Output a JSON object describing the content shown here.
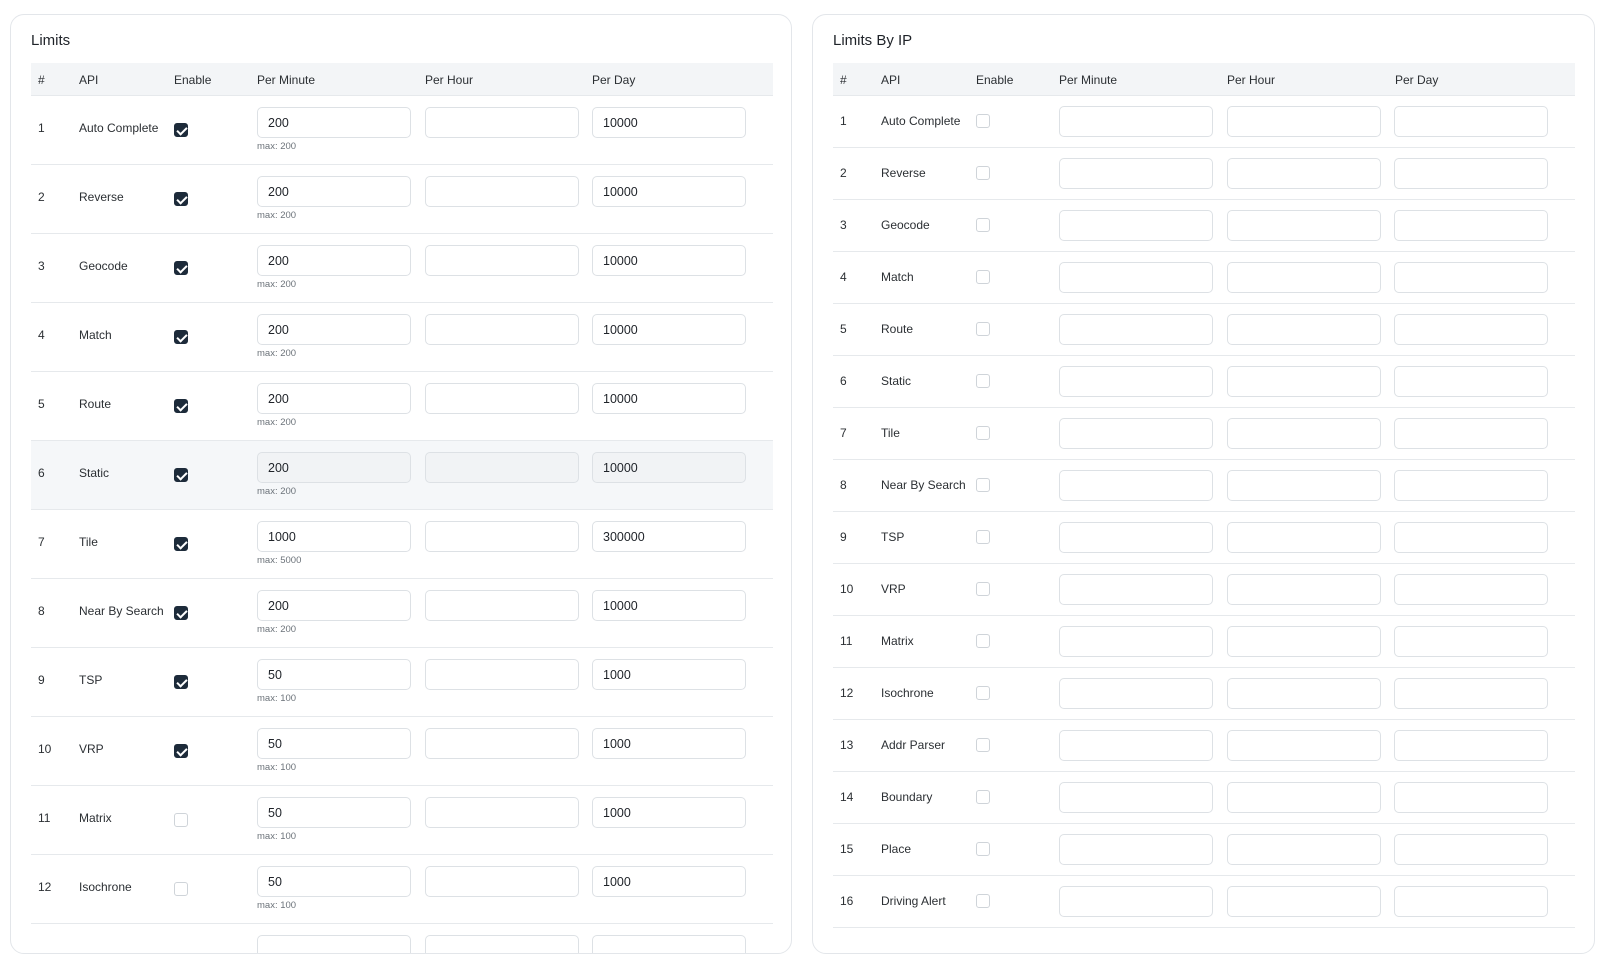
{
  "left": {
    "title": "Limits",
    "headers": [
      "#",
      "API",
      "Enable",
      "Per Minute",
      "Per Hour",
      "Per Day"
    ],
    "rows": [
      {
        "num": "1",
        "api": "Auto Complete",
        "enabled": true,
        "per_minute": "200",
        "per_hour": "",
        "per_day": "10000",
        "max": "max: 200"
      },
      {
        "num": "2",
        "api": "Reverse",
        "enabled": true,
        "per_minute": "200",
        "per_hour": "",
        "per_day": "10000",
        "max": "max: 200"
      },
      {
        "num": "3",
        "api": "Geocode",
        "enabled": true,
        "per_minute": "200",
        "per_hour": "",
        "per_day": "10000",
        "max": "max: 200"
      },
      {
        "num": "4",
        "api": "Match",
        "enabled": true,
        "per_minute": "200",
        "per_hour": "",
        "per_day": "10000",
        "max": "max: 200"
      },
      {
        "num": "5",
        "api": "Route",
        "enabled": true,
        "per_minute": "200",
        "per_hour": "",
        "per_day": "10000",
        "max": "max: 200"
      },
      {
        "num": "6",
        "api": "Static",
        "enabled": true,
        "per_minute": "200",
        "per_hour": "",
        "per_day": "10000",
        "max": "max: 200",
        "highlighted": true
      },
      {
        "num": "7",
        "api": "Tile",
        "enabled": true,
        "per_minute": "1000",
        "per_hour": "",
        "per_day": "300000",
        "max": "max: 5000"
      },
      {
        "num": "8",
        "api": "Near By Search",
        "enabled": true,
        "per_minute": "200",
        "per_hour": "",
        "per_day": "10000",
        "max": "max: 200"
      },
      {
        "num": "9",
        "api": "TSP",
        "enabled": true,
        "per_minute": "50",
        "per_hour": "",
        "per_day": "1000",
        "max": "max: 100"
      },
      {
        "num": "10",
        "api": "VRP",
        "enabled": true,
        "per_minute": "50",
        "per_hour": "",
        "per_day": "1000",
        "max": "max: 100"
      },
      {
        "num": "11",
        "api": "Matrix",
        "enabled": false,
        "per_minute": "50",
        "per_hour": "",
        "per_day": "1000",
        "max": "max: 100"
      },
      {
        "num": "12",
        "api": "Isochrone",
        "enabled": false,
        "per_minute": "50",
        "per_hour": "",
        "per_day": "1000",
        "max": "max: 100"
      },
      {
        "num": "",
        "api": "",
        "enabled": false,
        "per_minute": "",
        "per_hour": "",
        "per_day": "",
        "max": ""
      }
    ]
  },
  "right": {
    "title": "Limits By IP",
    "headers": [
      "#",
      "API",
      "Enable",
      "Per Minute",
      "Per Hour",
      "Per Day"
    ],
    "rows": [
      {
        "num": "1",
        "api": "Auto Complete",
        "enabled": false,
        "per_minute": "",
        "per_hour": "",
        "per_day": ""
      },
      {
        "num": "2",
        "api": "Reverse",
        "enabled": false,
        "per_minute": "",
        "per_hour": "",
        "per_day": ""
      },
      {
        "num": "3",
        "api": "Geocode",
        "enabled": false,
        "per_minute": "",
        "per_hour": "",
        "per_day": ""
      },
      {
        "num": "4",
        "api": "Match",
        "enabled": false,
        "per_minute": "",
        "per_hour": "",
        "per_day": ""
      },
      {
        "num": "5",
        "api": "Route",
        "enabled": false,
        "per_minute": "",
        "per_hour": "",
        "per_day": ""
      },
      {
        "num": "6",
        "api": "Static",
        "enabled": false,
        "per_minute": "",
        "per_hour": "",
        "per_day": ""
      },
      {
        "num": "7",
        "api": "Tile",
        "enabled": false,
        "per_minute": "",
        "per_hour": "",
        "per_day": ""
      },
      {
        "num": "8",
        "api": "Near By Search",
        "enabled": false,
        "per_minute": "",
        "per_hour": "",
        "per_day": ""
      },
      {
        "num": "9",
        "api": "TSP",
        "enabled": false,
        "per_minute": "",
        "per_hour": "",
        "per_day": ""
      },
      {
        "num": "10",
        "api": "VRP",
        "enabled": false,
        "per_minute": "",
        "per_hour": "",
        "per_day": ""
      },
      {
        "num": "11",
        "api": "Matrix",
        "enabled": false,
        "per_minute": "",
        "per_hour": "",
        "per_day": ""
      },
      {
        "num": "12",
        "api": "Isochrone",
        "enabled": false,
        "per_minute": "",
        "per_hour": "",
        "per_day": ""
      },
      {
        "num": "13",
        "api": "Addr Parser",
        "enabled": false,
        "per_minute": "",
        "per_hour": "",
        "per_day": ""
      },
      {
        "num": "14",
        "api": "Boundary",
        "enabled": false,
        "per_minute": "",
        "per_hour": "",
        "per_day": ""
      },
      {
        "num": "15",
        "api": "Place",
        "enabled": false,
        "per_minute": "",
        "per_hour": "",
        "per_day": ""
      },
      {
        "num": "16",
        "api": "Driving Alert",
        "enabled": false,
        "per_minute": "",
        "per_hour": "",
        "per_day": ""
      }
    ]
  },
  "colors": {
    "checkbox_checked": "#1d2b3a",
    "header_bg": "#f3f5f7",
    "highlight_row": "#f5f7f9"
  }
}
